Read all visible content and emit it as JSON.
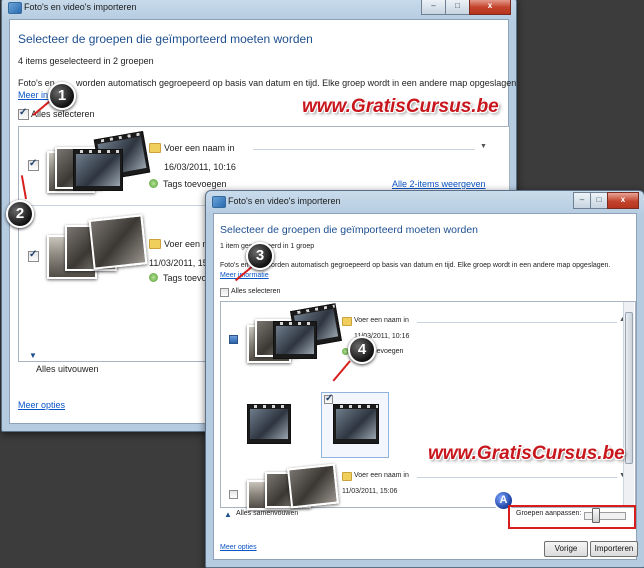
{
  "window_back": {
    "title": "Foto's en video's importeren",
    "heading": "Selecteer de groepen die geïmporteerd moeten worden",
    "count_text": "4 items geselecteerd in 2 groepen",
    "info_text": "Foto's en video's worden automatisch gegroepeerd op basis van datum en tijd. Elke groep wordt in een andere map opgeslagen.",
    "info_prefix": "Foto's en",
    "info_suffix": "worden automatisch gegroepeerd op basis van datum en tijd. Elke groep wordt in een andere map opgeslagen.",
    "more_info_link": "Meer info",
    "select_all_label": "Alles selecteren",
    "select_all_checked": true,
    "groups": [
      {
        "checked": true,
        "name_placeholder": "Voer een naam in",
        "date": "16/03/2011, 10:16",
        "tags": "Tags toevoegen",
        "view_all": "Alle 2-items weergeven"
      },
      {
        "checked": true,
        "name_placeholder": "Voer een naam in",
        "date": "11/03/2011, 15:06",
        "tags": "Tags toevoegen"
      }
    ],
    "expand_all": "Alles uitvouwen",
    "more_options": "Meer opties",
    "controls": {
      "minimize": "–",
      "maximize": "□",
      "close": "x"
    }
  },
  "window_front": {
    "title": "Foto's en video's importeren",
    "heading": "Selecteer de groepen die geïmporteerd moeten worden",
    "count_text": "1 item geselecteerd in 1 groep",
    "info_prefix": "Foto's en",
    "info_suffix": "worden automatisch gegroepeerd op basis van datum en tijd. Elke groep wordt in een andere map opgeslagen.",
    "more_info_link": "Meer informatie",
    "select_all_label": "Alles selecteren",
    "select_all_checked": false,
    "groups": [
      {
        "checked": "partial",
        "name_placeholder": "Voer een naam in",
        "date": "11/03/2011, 10:16",
        "tags": "Tags toevoegen"
      },
      {
        "checked": false,
        "name_placeholder": "Voer een naam in",
        "date": "11/03/2011, 15:06"
      }
    ],
    "collapse_all": "Alles samenvouwen",
    "groups_adjust_label": "Groepen aanpassen:",
    "more_options": "Meer opties",
    "buttons": {
      "back": "Vorige",
      "import": "Importeren"
    },
    "controls": {
      "minimize": "–",
      "maximize": "□",
      "close": "x"
    }
  },
  "annotations": {
    "badges": [
      "1",
      "2",
      "3",
      "4"
    ],
    "badge_a": "A",
    "watermark": "www.GratisCursus.be",
    "accent_color": "#d81d1d"
  }
}
